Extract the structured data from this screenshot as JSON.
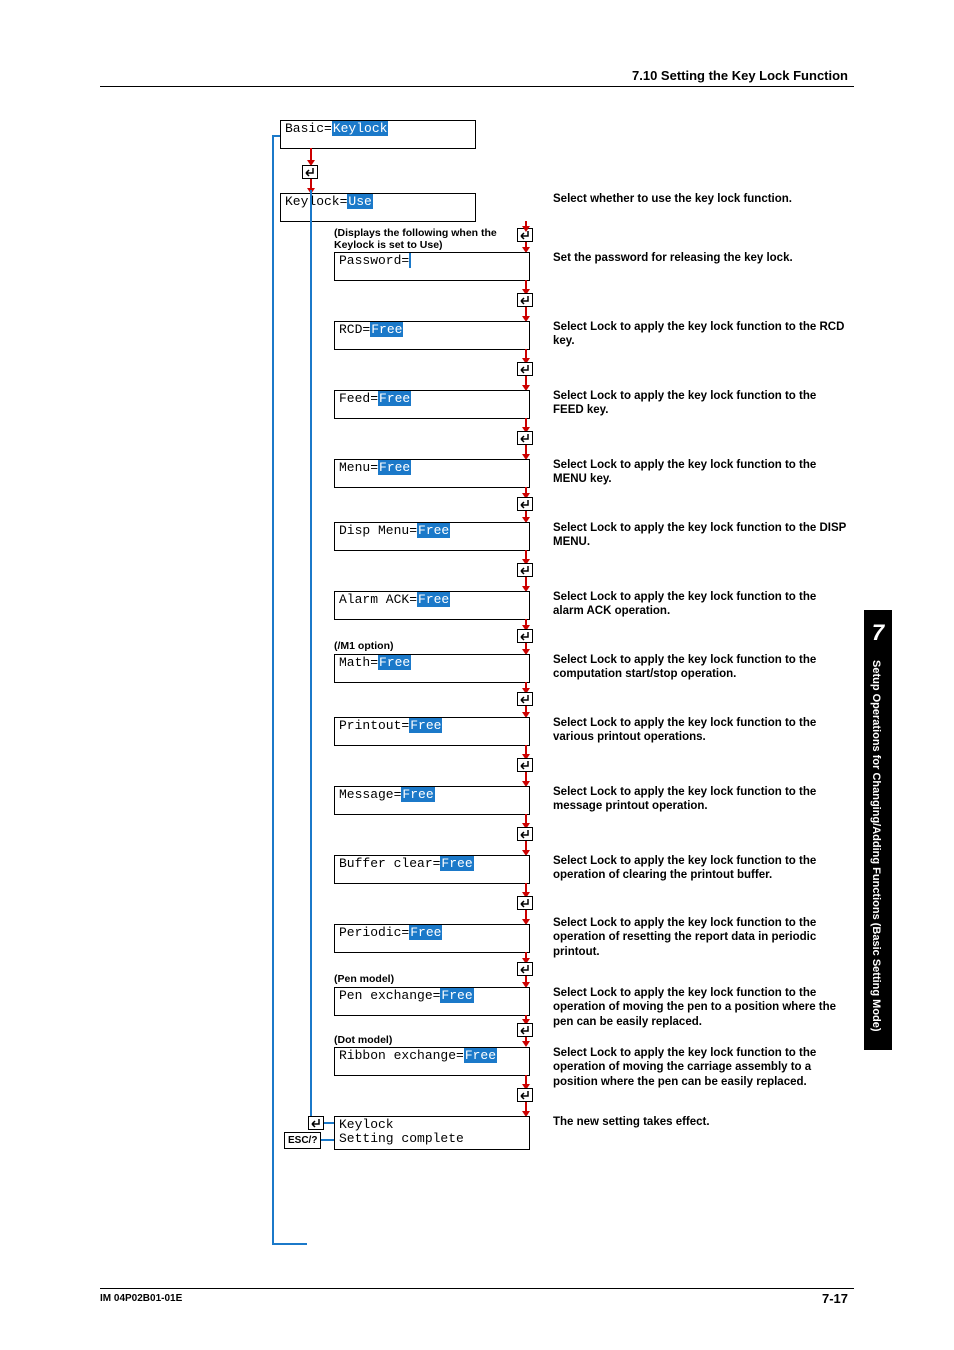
{
  "header": {
    "section": "7.10  Setting the Key Lock Function"
  },
  "side": {
    "num": "7",
    "text": "Setup Operations for Changing/Adding Functions (Basic Setting Mode)"
  },
  "rows": {
    "basic": {
      "lbl": "Basic=",
      "val": "Keylock"
    },
    "keylock": {
      "lbl": "Keylock=",
      "val": "Use",
      "desc": "Select whether to use the key lock function."
    },
    "note1": {
      "l1": "(Displays the following when the",
      "l2": "Keylock is set to Use)"
    },
    "password": {
      "lbl": "Password=",
      "val": " ",
      "desc": "Set the password for releasing the key lock."
    },
    "rcd": {
      "lbl": "RCD=",
      "val": "Free",
      "desc": "Select Lock to apply the key lock function to the RCD key."
    },
    "feed": {
      "lbl": "Feed=",
      "val": "Free",
      "desc": "Select Lock to apply the key lock function to the FEED key."
    },
    "menu": {
      "lbl": "Menu=",
      "val": "Free",
      "desc": "Select Lock to apply the key lock function to the MENU key."
    },
    "disp": {
      "lbl": "Disp Menu=",
      "val": "Free",
      "desc": "Select Lock to apply the key lock function to the DISP MENU."
    },
    "alarm": {
      "lbl": "Alarm ACK=",
      "val": "Free",
      "desc": "Select Lock to apply the key lock function to the alarm ACK operation."
    },
    "note2": {
      "l1": "(/M1 option)"
    },
    "math": {
      "lbl": "Math=",
      "val": "Free",
      "desc": "Select Lock to apply the key lock function to the computation start/stop operation."
    },
    "print": {
      "lbl": "Printout=",
      "val": "Free",
      "desc": "Select Lock to apply the key lock function to the various printout operations."
    },
    "message": {
      "lbl": "Message=",
      "val": "Free",
      "desc": "Select Lock to apply the key lock function to the message printout operation."
    },
    "buffer": {
      "lbl": "Buffer clear=",
      "val": "Free",
      "desc": "Select Lock to apply the key lock function to the operation of clearing the printout buffer."
    },
    "periodic": {
      "lbl": "Periodic=",
      "val": "Free",
      "desc": "Select Lock to apply the key lock function to the operation of resetting the report data in periodic printout."
    },
    "note3": {
      "l1": "(Pen model)"
    },
    "pen": {
      "lbl": "Pen exchange=",
      "val": "Free",
      "desc": "Select Lock to apply the key lock function to the operation of moving the pen to a position where the pen can be easily replaced."
    },
    "note4": {
      "l1": "(Dot model)"
    },
    "ribbon": {
      "lbl": "Ribbon exchange=",
      "val": "Free",
      "desc": "Select Lock to apply the key lock function to the operation of moving the carriage assembly to a position where the pen can be easily replaced."
    },
    "final": {
      "l1": "Keylock",
      "l2": "Setting complete",
      "desc": "The new setting takes effect."
    }
  },
  "esc": "ESC/?",
  "footer": {
    "left": "IM 04P02B01-01E",
    "right": "7-17"
  }
}
